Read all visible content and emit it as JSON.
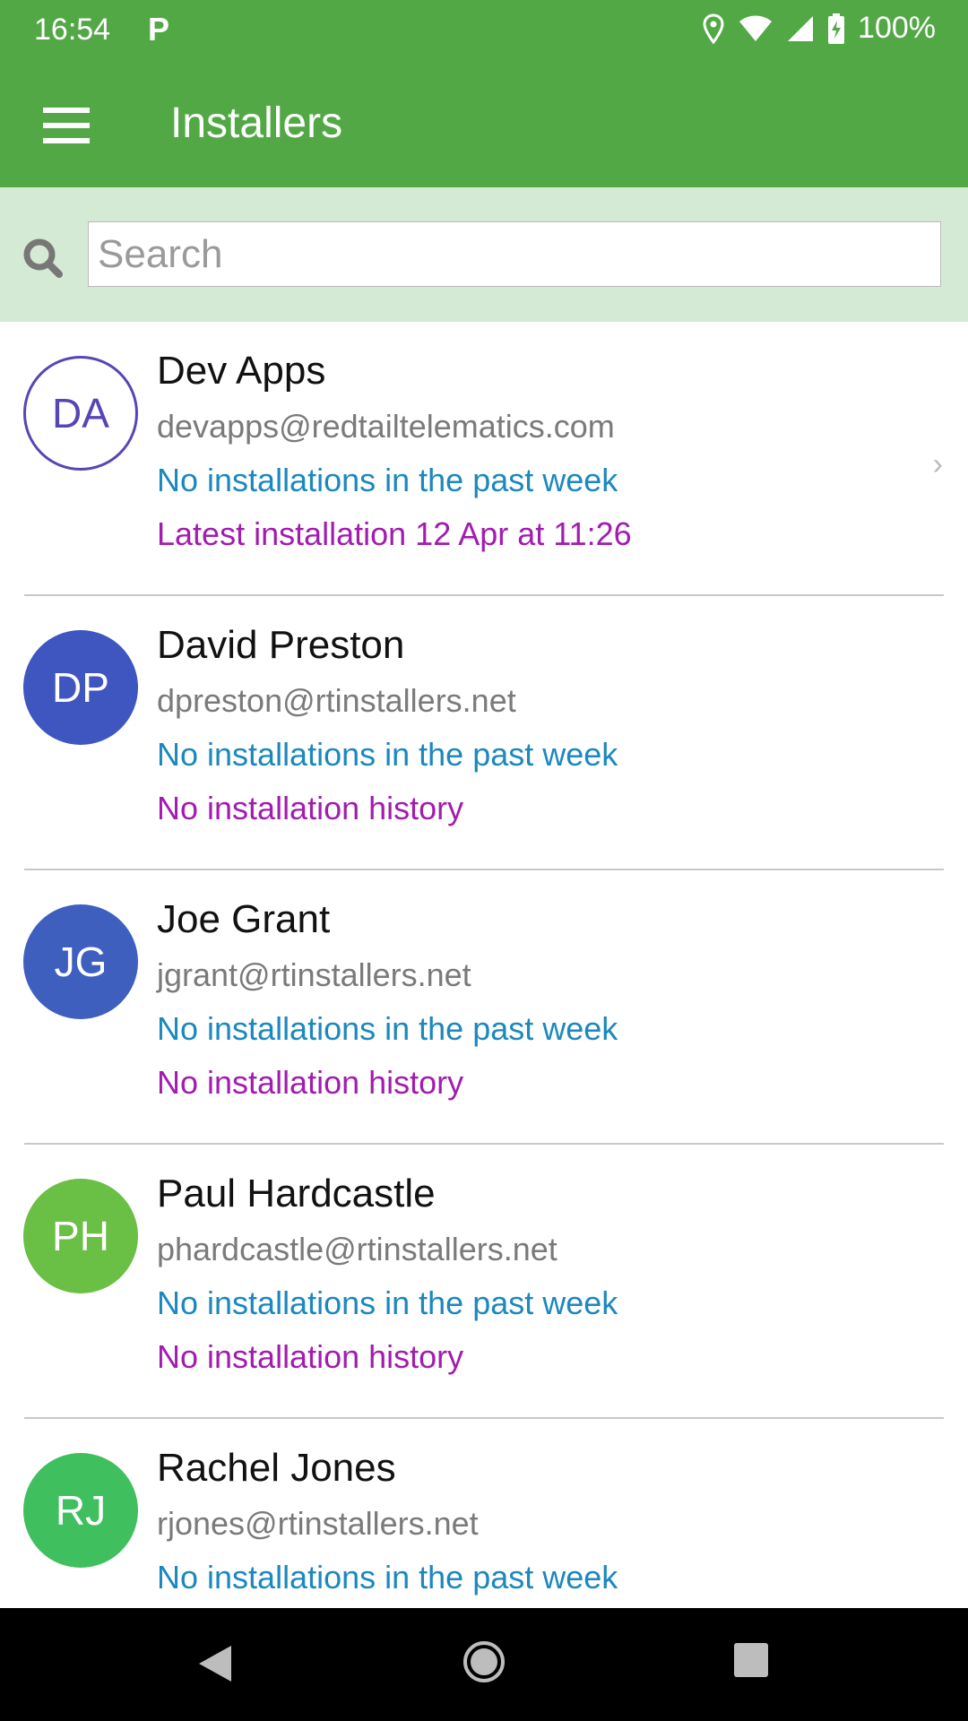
{
  "status_bar": {
    "time": "16:54",
    "notification_icon": "parking-p-icon",
    "battery": "100%"
  },
  "app_bar": {
    "title": "Installers",
    "menu_icon": "hamburger-menu-icon"
  },
  "search": {
    "placeholder": "Search",
    "value": ""
  },
  "colors": {
    "primary": "#53A846",
    "search_bg": "#D4EAD4",
    "week_text": "#1B88BE",
    "history_text": "#A21CAF"
  },
  "installers": [
    {
      "initials": "DA",
      "name": "Dev Apps",
      "email": "devapps@redtailtelematics.com",
      "week": "No installations in the past week",
      "history": "Latest installation 12 Apr at 11:26",
      "avatar_color": "#5546B5",
      "avatar_outlined": true
    },
    {
      "initials": "DP",
      "name": "David Preston",
      "email": "dpreston@rtinstallers.net",
      "week": "No installations in the past week",
      "history": "No installation history",
      "avatar_color": "#3F55BF"
    },
    {
      "initials": "JG",
      "name": "Joe Grant",
      "email": "jgrant@rtinstallers.net",
      "week": "No installations in the past week",
      "history": "No installation history",
      "avatar_color": "#3F5FBF"
    },
    {
      "initials": "PH",
      "name": "Paul Hardcastle",
      "email": "phardcastle@rtinstallers.net",
      "week": "No installations in the past week",
      "history": "No installation history",
      "avatar_color": "#6ABF45"
    },
    {
      "initials": "RJ",
      "name": "Rachel Jones",
      "email": "rjones@rtinstallers.net",
      "week": "No installations in the past week",
      "history": "",
      "avatar_color": "#40BF5F"
    }
  ]
}
